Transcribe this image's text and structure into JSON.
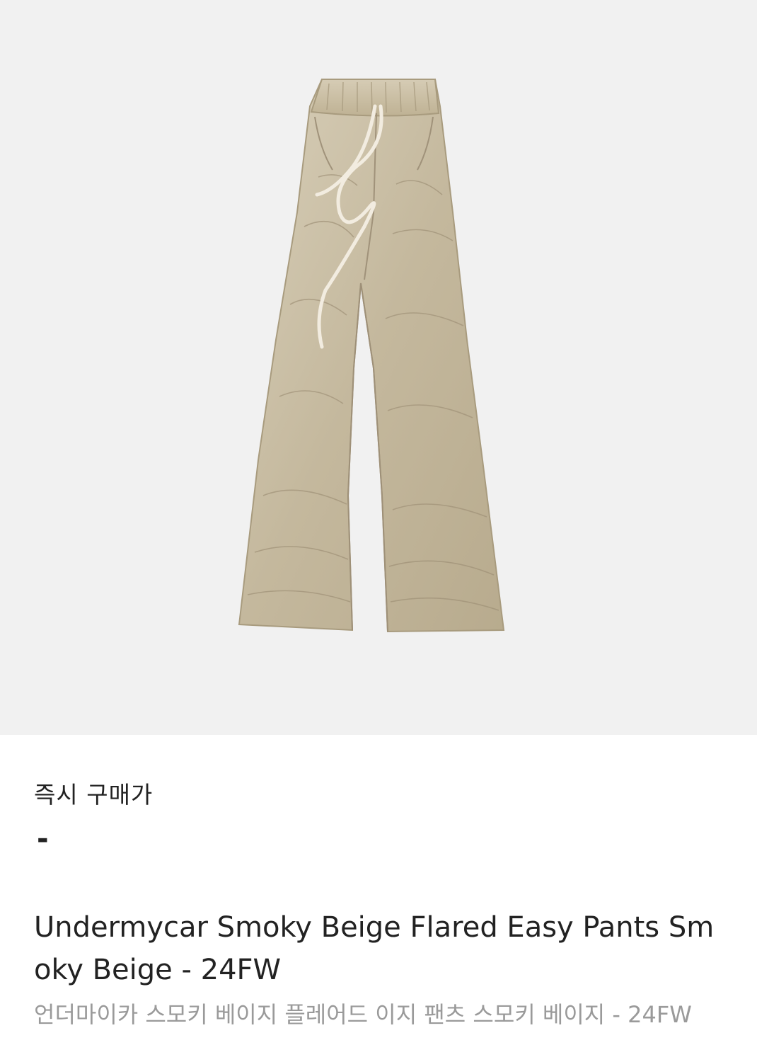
{
  "product": {
    "image_alt": "Undermycar Smoky Beige Flared Easy Pants",
    "background_color": "#f1f1f1",
    "garment_color": "#c9bea4"
  },
  "price": {
    "label": "즉시 구매가",
    "value": "-"
  },
  "title": {
    "english": "Undermycar Smoky Beige Flared Easy Pants Smoky Beige - 24FW",
    "korean": "언더마이카 스모키 베이지 플레어드 이지 팬츠 스모키 베이지 - 24FW"
  }
}
